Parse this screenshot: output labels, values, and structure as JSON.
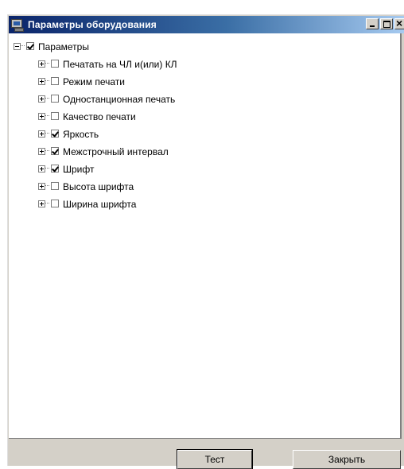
{
  "window": {
    "title": "Параметры оборудования"
  },
  "tree": {
    "root": {
      "label": "Параметры",
      "checked": true,
      "expanded": true
    },
    "items": [
      {
        "label": "Печатать на ЧЛ и(или) КЛ",
        "checked": false
      },
      {
        "label": "Режим печати",
        "checked": false
      },
      {
        "label": "Одностанционная печать",
        "checked": false
      },
      {
        "label": "Качество печати",
        "checked": false
      },
      {
        "label": "Яркость",
        "checked": true
      },
      {
        "label": "Межстрочный интервал",
        "checked": true
      },
      {
        "label": "Шрифт",
        "checked": true
      },
      {
        "label": "Высота шрифта",
        "checked": false
      },
      {
        "label": "Ширина шрифта",
        "checked": false
      }
    ]
  },
  "buttons": {
    "test_label": "Тест",
    "close_label": "Закрыть"
  }
}
